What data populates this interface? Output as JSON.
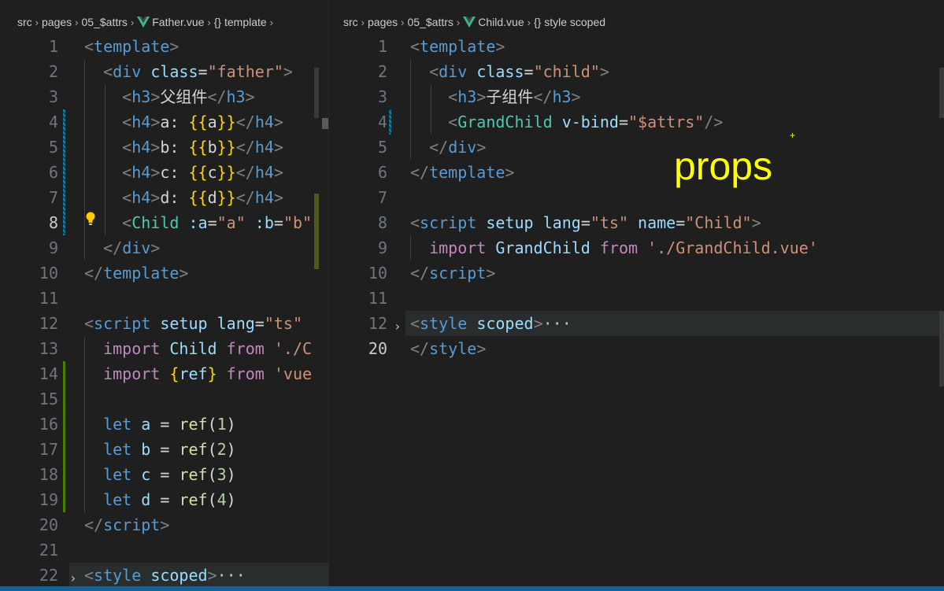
{
  "left_editor": {
    "breadcrumb": [
      "src",
      "pages",
      "05_$attrs",
      "Father.vue",
      "{} template"
    ],
    "lines": [
      {
        "n": "1",
        "parts": [
          [
            "tag",
            "<"
          ],
          [
            "tn",
            "template"
          ],
          [
            "tag",
            ">"
          ]
        ]
      },
      {
        "n": "2",
        "parts": [
          [
            "tx",
            "  "
          ],
          [
            "tag",
            "<"
          ],
          [
            "tn",
            "div"
          ],
          [
            "tx",
            " "
          ],
          [
            "at",
            "class"
          ],
          [
            "tx",
            "="
          ],
          [
            "st",
            "\"father\""
          ],
          [
            "tag",
            ">"
          ]
        ]
      },
      {
        "n": "3",
        "parts": [
          [
            "tx",
            "    "
          ],
          [
            "tag",
            "<"
          ],
          [
            "tn",
            "h3"
          ],
          [
            "tag",
            ">"
          ],
          [
            "tx",
            "父组件"
          ],
          [
            "tag",
            "</"
          ],
          [
            "tn",
            "h3"
          ],
          [
            "tag",
            ">"
          ]
        ]
      },
      {
        "n": "4",
        "parts": [
          [
            "tx",
            "    "
          ],
          [
            "tag",
            "<"
          ],
          [
            "tn",
            "h4"
          ],
          [
            "tag",
            ">"
          ],
          [
            "tx",
            "a: "
          ],
          [
            "br",
            "{{"
          ],
          [
            "tx",
            "a"
          ],
          [
            "br",
            "}}"
          ],
          [
            "tag",
            "</"
          ],
          [
            "tn",
            "h4"
          ],
          [
            "tag",
            ">"
          ]
        ]
      },
      {
        "n": "5",
        "parts": [
          [
            "tx",
            "    "
          ],
          [
            "tag",
            "<"
          ],
          [
            "tn",
            "h4"
          ],
          [
            "tag",
            ">"
          ],
          [
            "tx",
            "b: "
          ],
          [
            "br",
            "{{"
          ],
          [
            "tx",
            "b"
          ],
          [
            "br",
            "}}"
          ],
          [
            "tag",
            "</"
          ],
          [
            "tn",
            "h4"
          ],
          [
            "tag",
            ">"
          ]
        ]
      },
      {
        "n": "6",
        "parts": [
          [
            "tx",
            "    "
          ],
          [
            "tag",
            "<"
          ],
          [
            "tn",
            "h4"
          ],
          [
            "tag",
            ">"
          ],
          [
            "tx",
            "c: "
          ],
          [
            "br",
            "{{"
          ],
          [
            "tx",
            "c"
          ],
          [
            "br",
            "}}"
          ],
          [
            "tag",
            "</"
          ],
          [
            "tn",
            "h4"
          ],
          [
            "tag",
            ">"
          ]
        ]
      },
      {
        "n": "7",
        "parts": [
          [
            "tx",
            "    "
          ],
          [
            "tag",
            "<"
          ],
          [
            "tn",
            "h4"
          ],
          [
            "tag",
            ">"
          ],
          [
            "tx",
            "d: "
          ],
          [
            "br",
            "{{"
          ],
          [
            "tx",
            "d"
          ],
          [
            "br",
            "}}"
          ],
          [
            "tag",
            "</"
          ],
          [
            "tn",
            "h4"
          ],
          [
            "tag",
            ">"
          ]
        ]
      },
      {
        "n": "8",
        "parts": [
          [
            "tx",
            "    "
          ],
          [
            "tag",
            "<"
          ],
          [
            "cmp",
            "Child"
          ],
          [
            "tx",
            " "
          ],
          [
            "at",
            ":a"
          ],
          [
            "tx",
            "="
          ],
          [
            "st",
            "\"a\""
          ],
          [
            "tx",
            " "
          ],
          [
            "at",
            ":b"
          ],
          [
            "tx",
            "="
          ],
          [
            "st",
            "\"b\""
          ]
        ]
      },
      {
        "n": "9",
        "parts": [
          [
            "tx",
            "  "
          ],
          [
            "tag",
            "</"
          ],
          [
            "tn",
            "div"
          ],
          [
            "tag",
            ">"
          ]
        ]
      },
      {
        "n": "10",
        "parts": [
          [
            "tag",
            "</"
          ],
          [
            "tn",
            "template"
          ],
          [
            "tag",
            ">"
          ]
        ]
      },
      {
        "n": "11",
        "parts": []
      },
      {
        "n": "12",
        "parts": [
          [
            "tag",
            "<"
          ],
          [
            "tn",
            "script"
          ],
          [
            "tx",
            " "
          ],
          [
            "at",
            "setup"
          ],
          [
            "tx",
            " "
          ],
          [
            "at",
            "lang"
          ],
          [
            "tx",
            "="
          ],
          [
            "st",
            "\"ts\""
          ]
        ]
      },
      {
        "n": "13",
        "parts": [
          [
            "tx",
            "  "
          ],
          [
            "ikw",
            "import"
          ],
          [
            "tx",
            " "
          ],
          [
            "at",
            "Child"
          ],
          [
            "tx",
            " "
          ],
          [
            "ikw",
            "from"
          ],
          [
            "tx",
            " "
          ],
          [
            "st",
            "'./C"
          ]
        ]
      },
      {
        "n": "14",
        "parts": [
          [
            "tx",
            "  "
          ],
          [
            "ikw",
            "import"
          ],
          [
            "tx",
            " "
          ],
          [
            "br",
            "{"
          ],
          [
            "at",
            "ref"
          ],
          [
            "br",
            "}"
          ],
          [
            "tx",
            " "
          ],
          [
            "ikw",
            "from"
          ],
          [
            "tx",
            " "
          ],
          [
            "st",
            "'vue"
          ]
        ]
      },
      {
        "n": "15",
        "parts": []
      },
      {
        "n": "16",
        "parts": [
          [
            "tx",
            "  "
          ],
          [
            "kw",
            "let"
          ],
          [
            "tx",
            " "
          ],
          [
            "at",
            "a"
          ],
          [
            "tx",
            " = "
          ],
          [
            "fn",
            "ref"
          ],
          [
            "tx",
            "("
          ],
          [
            "num",
            "1"
          ],
          [
            "tx",
            ")"
          ]
        ]
      },
      {
        "n": "17",
        "parts": [
          [
            "tx",
            "  "
          ],
          [
            "kw",
            "let"
          ],
          [
            "tx",
            " "
          ],
          [
            "at",
            "b"
          ],
          [
            "tx",
            " = "
          ],
          [
            "fn",
            "ref"
          ],
          [
            "tx",
            "("
          ],
          [
            "num",
            "2"
          ],
          [
            "tx",
            ")"
          ]
        ]
      },
      {
        "n": "18",
        "parts": [
          [
            "tx",
            "  "
          ],
          [
            "kw",
            "let"
          ],
          [
            "tx",
            " "
          ],
          [
            "at",
            "c"
          ],
          [
            "tx",
            " = "
          ],
          [
            "fn",
            "ref"
          ],
          [
            "tx",
            "("
          ],
          [
            "num",
            "3"
          ],
          [
            "tx",
            ")"
          ]
        ]
      },
      {
        "n": "19",
        "parts": [
          [
            "tx",
            "  "
          ],
          [
            "kw",
            "let"
          ],
          [
            "tx",
            " "
          ],
          [
            "at",
            "d"
          ],
          [
            "tx",
            " = "
          ],
          [
            "fn",
            "ref"
          ],
          [
            "tx",
            "("
          ],
          [
            "num",
            "4"
          ],
          [
            "tx",
            ")"
          ]
        ]
      },
      {
        "n": "20",
        "parts": [
          [
            "tag",
            "</"
          ],
          [
            "tn",
            "script"
          ],
          [
            "tag",
            ">"
          ]
        ]
      },
      {
        "n": "21",
        "parts": []
      },
      {
        "n": "22",
        "parts": [
          [
            "tag",
            "<"
          ],
          [
            "tn",
            "style"
          ],
          [
            "tx",
            " "
          ],
          [
            "at",
            "scoped"
          ],
          [
            "tag",
            ">"
          ],
          [
            "ellipsis",
            "···"
          ]
        ]
      }
    ]
  },
  "right_editor": {
    "breadcrumb": [
      "src",
      "pages",
      "05_$attrs",
      "Child.vue",
      "{} style scoped"
    ],
    "lines": [
      {
        "n": "1",
        "parts": [
          [
            "tag",
            "<"
          ],
          [
            "tn",
            "template"
          ],
          [
            "tag",
            ">"
          ]
        ]
      },
      {
        "n": "2",
        "parts": [
          [
            "tx",
            "  "
          ],
          [
            "tag",
            "<"
          ],
          [
            "tn",
            "div"
          ],
          [
            "tx",
            " "
          ],
          [
            "at",
            "class"
          ],
          [
            "tx",
            "="
          ],
          [
            "st",
            "\"child\""
          ],
          [
            "tag",
            ">"
          ]
        ]
      },
      {
        "n": "3",
        "parts": [
          [
            "tx",
            "    "
          ],
          [
            "tag",
            "<"
          ],
          [
            "tn",
            "h3"
          ],
          [
            "tag",
            ">"
          ],
          [
            "tx",
            "子组件"
          ],
          [
            "tag",
            "</"
          ],
          [
            "tn",
            "h3"
          ],
          [
            "tag",
            ">"
          ]
        ]
      },
      {
        "n": "4",
        "parts": [
          [
            "tx",
            "    "
          ],
          [
            "tag",
            "<"
          ],
          [
            "cmp",
            "GrandChild"
          ],
          [
            "tx",
            " "
          ],
          [
            "at",
            "v-bind"
          ],
          [
            "tx",
            "="
          ],
          [
            "st",
            "\"$attrs\""
          ],
          [
            "tag",
            "/>"
          ]
        ]
      },
      {
        "n": "5",
        "parts": [
          [
            "tx",
            "  "
          ],
          [
            "tag",
            "</"
          ],
          [
            "tn",
            "div"
          ],
          [
            "tag",
            ">"
          ]
        ]
      },
      {
        "n": "6",
        "parts": [
          [
            "tag",
            "</"
          ],
          [
            "tn",
            "template"
          ],
          [
            "tag",
            ">"
          ]
        ]
      },
      {
        "n": "7",
        "parts": []
      },
      {
        "n": "8",
        "parts": [
          [
            "tag",
            "<"
          ],
          [
            "tn",
            "script"
          ],
          [
            "tx",
            " "
          ],
          [
            "at",
            "setup"
          ],
          [
            "tx",
            " "
          ],
          [
            "at",
            "lang"
          ],
          [
            "tx",
            "="
          ],
          [
            "st",
            "\"ts\""
          ],
          [
            "tx",
            " "
          ],
          [
            "at",
            "name"
          ],
          [
            "tx",
            "="
          ],
          [
            "st",
            "\"Child\""
          ],
          [
            "tag",
            ">"
          ]
        ]
      },
      {
        "n": "9",
        "parts": [
          [
            "tx",
            "  "
          ],
          [
            "ikw",
            "import"
          ],
          [
            "tx",
            " "
          ],
          [
            "at",
            "GrandChild"
          ],
          [
            "tx",
            " "
          ],
          [
            "ikw",
            "from"
          ],
          [
            "tx",
            " "
          ],
          [
            "st",
            "'./GrandChild.vue'"
          ]
        ]
      },
      {
        "n": "10",
        "parts": [
          [
            "tag",
            "</"
          ],
          [
            "tn",
            "script"
          ],
          [
            "tag",
            ">"
          ]
        ]
      },
      {
        "n": "11",
        "parts": []
      },
      {
        "n": "12",
        "parts": [
          [
            "tag",
            "<"
          ],
          [
            "tn",
            "style"
          ],
          [
            "tx",
            " "
          ],
          [
            "at",
            "scoped"
          ],
          [
            "tag",
            ">"
          ],
          [
            "ellipsis",
            "···"
          ]
        ]
      },
      {
        "n": "20",
        "parts": [
          [
            "tag",
            "</"
          ],
          [
            "tn",
            "style"
          ],
          [
            "tag",
            ">"
          ]
        ]
      }
    ]
  },
  "overlay": {
    "annotation_text": "props",
    "annotation_color": "#ffff00"
  },
  "icons": {
    "file_icon": "vue-logo-icon",
    "lightbulb": "lightbulb-icon",
    "fold": "chevron-right-icon"
  }
}
